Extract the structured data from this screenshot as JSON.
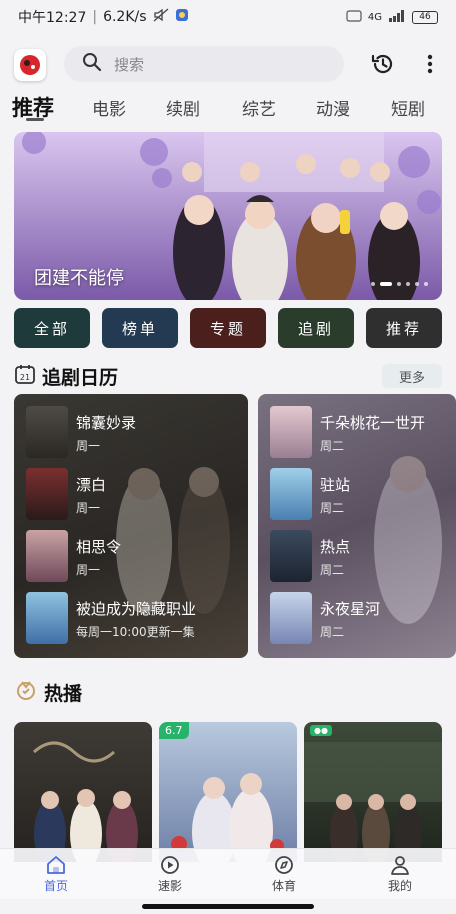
{
  "status_bar": {
    "time": "中午12:27",
    "speed": "6.2K/s",
    "network": "4G",
    "battery": "46"
  },
  "search": {
    "placeholder": "搜索"
  },
  "tabs": [
    {
      "label": "推荐",
      "active": true
    },
    {
      "label": "电影"
    },
    {
      "label": "续剧"
    },
    {
      "label": "综艺"
    },
    {
      "label": "动漫"
    },
    {
      "label": "短剧"
    }
  ],
  "banner": {
    "caption": "团建不能停",
    "slide_index": 2,
    "slide_count": 6
  },
  "quick_links": [
    {
      "label": "全部",
      "color": "#1f3a3a"
    },
    {
      "label": "榜单",
      "color": "#233a52"
    },
    {
      "label": "专题",
      "color": "#4a1f1c"
    },
    {
      "label": "追剧",
      "color": "#2a3d2c"
    },
    {
      "label": "推荐",
      "color": "#2f2f2f"
    }
  ],
  "calendar": {
    "title": "追剧日历",
    "more": "更多",
    "left": [
      {
        "title": "锦囊妙录",
        "sub": "周一"
      },
      {
        "title": "漂白",
        "sub": "周一"
      },
      {
        "title": "相思令",
        "sub": "周一"
      },
      {
        "title": "被迫成为隐藏职业",
        "sub": "每周一10:00更新一集"
      }
    ],
    "right": [
      {
        "title": "千朵桃花一世开",
        "sub": "周二"
      },
      {
        "title": "驻站",
        "sub": "周二"
      },
      {
        "title": "热点",
        "sub": "周二"
      },
      {
        "title": "永夜星河",
        "sub": "周二"
      }
    ]
  },
  "hot": {
    "title": "热播",
    "cards": [
      {
        "score": ""
      },
      {
        "score": "6.7"
      },
      {
        "score": ""
      }
    ]
  },
  "bottom_nav": [
    {
      "label": "首页",
      "icon": "home-icon",
      "active": true
    },
    {
      "label": "速影",
      "icon": "play-circle-icon"
    },
    {
      "label": "体育",
      "icon": "compass-icon"
    },
    {
      "label": "我的",
      "icon": "user-icon"
    }
  ],
  "colors": {
    "accent": "#4c6bd6",
    "score_badge": "#27b36a"
  }
}
